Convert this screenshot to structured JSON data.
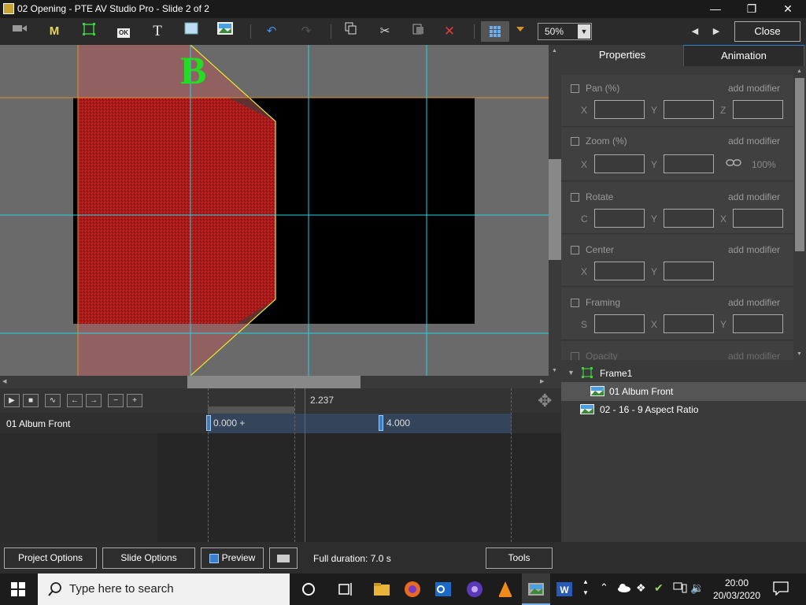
{
  "window": {
    "title": "02 Opening - PTE AV Studio Pro - Slide 2 of 2",
    "controls": [
      "—",
      "❐",
      "✕"
    ]
  },
  "toolbar": {
    "zoom_value": "50%",
    "close_label": "Close",
    "text_tool": "T",
    "mask_tool": "M",
    "ok_tool": "OK"
  },
  "canvas": {
    "letter": "B",
    "accent_green": "#22dd22",
    "guide_color": "#22d3e6",
    "guide_orange": "#e0902a"
  },
  "panel": {
    "tabs": [
      {
        "label": "Properties"
      },
      {
        "label": "Animation"
      }
    ],
    "groups": [
      {
        "label": "Pan (%)",
        "modifier": "add modifier",
        "axes": [
          "X",
          "Y",
          "Z"
        ]
      },
      {
        "label": "Zoom (%)",
        "modifier": "add modifier",
        "axes": [
          "X",
          "Y"
        ],
        "extra": "100%"
      },
      {
        "label": "Rotate",
        "modifier": "add modifier",
        "axes": [
          "C",
          "Y",
          "X"
        ]
      },
      {
        "label": "Center",
        "modifier": "add modifier",
        "axes": [
          "X",
          "Y"
        ]
      },
      {
        "label": "Framing",
        "modifier": "add modifier",
        "axes": [
          "S",
          "X",
          "Y"
        ]
      },
      {
        "label": "Opacity",
        "modifier": "add modifier"
      }
    ]
  },
  "tree": {
    "frame": "Frame1",
    "selected": "01 Album Front",
    "other": "02 - 16 - 9 Aspect Ratio"
  },
  "timeline": {
    "cursor_time": "2.237",
    "track_name": "01 Album Front",
    "keyframes": [
      {
        "label": "0.000 +"
      },
      {
        "label": "4.000"
      }
    ]
  },
  "bottom": {
    "project_options": "Project Options",
    "slide_options": "Slide Options",
    "preview": "Preview",
    "full_duration": "Full duration: 7.0 s",
    "tools": "Tools"
  },
  "taskbar": {
    "search_placeholder": "Type here to search",
    "time": "20:00",
    "date": "20/03/2020"
  }
}
